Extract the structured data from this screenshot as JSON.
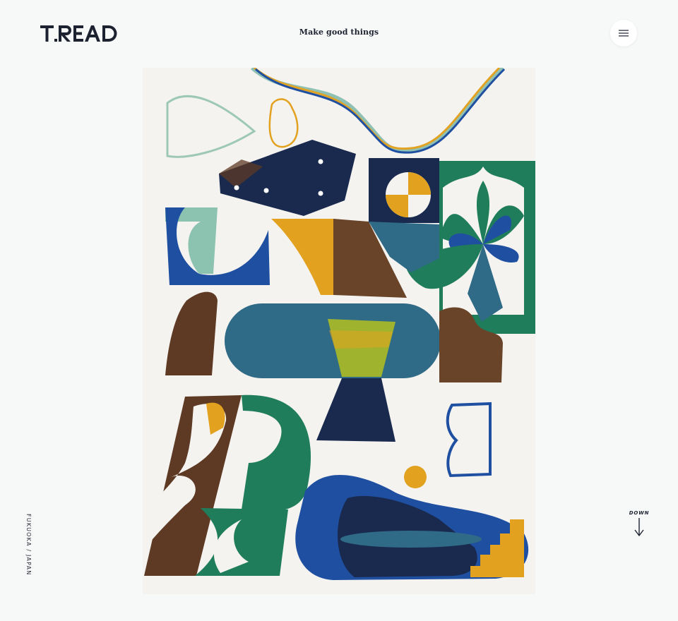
{
  "header": {
    "logo_text": "T.READ",
    "tagline": "Make good things",
    "menu_icon": "hamburger-icon"
  },
  "hero": {
    "artwork_icon": "abstract-paper-cutout-artwork"
  },
  "side": {
    "location": "FUKUOKA / JAPAN"
  },
  "scroll": {
    "label": "DOWN",
    "icon": "arrow-down-icon"
  },
  "colors": {
    "background": "#f7f8f8",
    "text": "#1d2230",
    "navy": "#1a2a4e",
    "blue": "#1f4fa0",
    "teal": "#2f6b86",
    "green": "#1f7d5c",
    "mustard": "#e2a21f",
    "brown": "#5e3a24",
    "mint": "#8cc2b0"
  }
}
